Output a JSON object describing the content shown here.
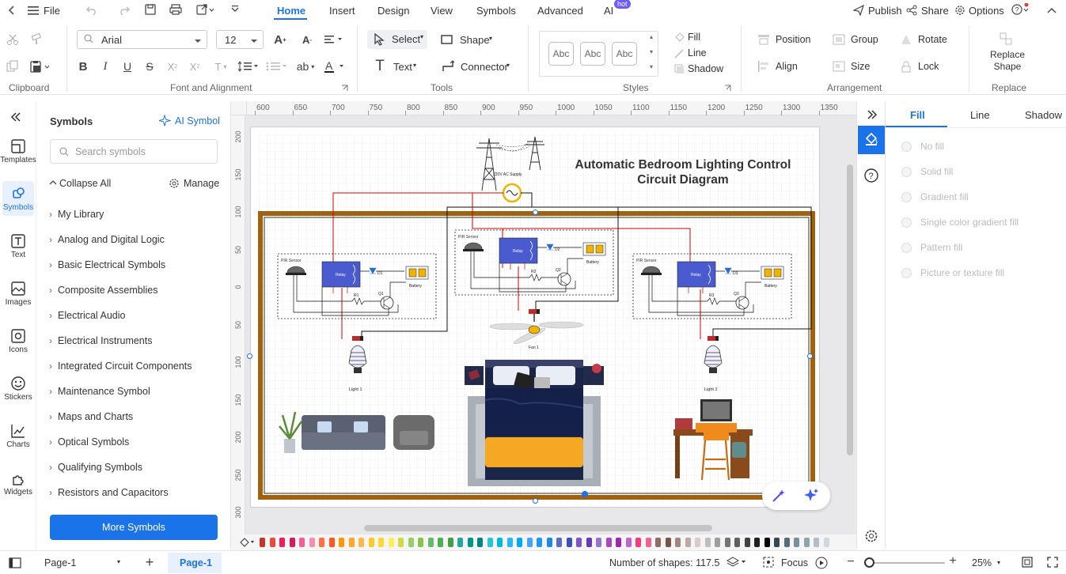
{
  "menubar": {
    "file_label": "File",
    "tabs": [
      "Home",
      "Insert",
      "Design",
      "View",
      "Symbols",
      "Advanced",
      "AI"
    ],
    "active_tab": "Home",
    "hot_badge": "hot",
    "publish_label": "Publish",
    "share_label": "Share",
    "options_label": "Options"
  },
  "ribbon": {
    "font_name": "Arial",
    "font_size": "12",
    "select_label": "Select",
    "shape_label": "Shape",
    "text_label": "Text",
    "connector_label": "Connector",
    "style_samples": [
      "Abc",
      "Abc",
      "Abc"
    ],
    "fill_label": "Fill",
    "line_label": "Line",
    "shadow_label": "Shadow",
    "position_label": "Position",
    "group_label": "Group",
    "rotate_label": "Rotate",
    "align_label": "Align",
    "size_label": "Size",
    "lock_label": "Lock",
    "replace_shape_label": "Replace Shape",
    "groups": {
      "clipboard": "Clipboard",
      "font": "Font and Alignment",
      "tools": "Tools",
      "styles": "Styles",
      "arrangement": "Arrangement",
      "replace": "Replace"
    }
  },
  "leftbar": {
    "items": [
      "Templates",
      "Symbols",
      "Text",
      "Images",
      "Icons",
      "Stickers",
      "Charts",
      "Widgets"
    ],
    "active": "Symbols"
  },
  "symbols_panel": {
    "title": "Symbols",
    "ai_symbol_label": "AI Symbol",
    "search_placeholder": "Search symbols",
    "collapse_all_label": "Collapse All",
    "manage_label": "Manage",
    "categories": [
      "My Library",
      "Analog and Digital Logic",
      "Basic Electrical Symbols",
      "Composite Assemblies",
      "Electrical Audio",
      "Electrical Instruments",
      "Integrated Circuit Components",
      "Maintenance Symbol",
      "Maps and Charts",
      "Optical Symbols",
      "Qualifying Symbols",
      "Resistors and Capacitors"
    ],
    "more_symbols_label": "More Symbols"
  },
  "ruler": {
    "h_ticks": [
      "600",
      "650",
      "700",
      "750",
      "800",
      "850",
      "900",
      "950",
      "1000",
      "1050",
      "1100",
      "1150",
      "1200",
      "1250",
      "1300",
      "1350"
    ],
    "v_ticks": [
      "200",
      "150",
      "100",
      "50",
      "0",
      "50",
      "100",
      "150",
      "200",
      "250",
      "300"
    ]
  },
  "diagram": {
    "title_line1": "Automatic Bedroom Lighting Control",
    "title_line2": "Circuit Diagram",
    "supply_label": "220V AC Supply",
    "pir_label": "PIR Sensor",
    "relay_label": "Relay",
    "battery_label": "Battery",
    "diode_labels": [
      "D1",
      "D2",
      "D3"
    ],
    "resistor_labels": [
      "R1",
      "R2",
      "R3"
    ],
    "transistor_labels": [
      "Q1",
      "Q2",
      "Q3"
    ],
    "fan_label": "Fan 1",
    "light_labels": [
      "Light 1",
      "Light 2"
    ]
  },
  "right_panel": {
    "tabs": [
      "Fill",
      "Line",
      "Shadow"
    ],
    "active_tab": "Fill",
    "fill_options": [
      "No fill",
      "Solid fill",
      "Gradient fill",
      "Single color gradient fill",
      "Pattern fill",
      "Picture or texture fill"
    ]
  },
  "palette": [
    "#c0392b",
    "#e74c3c",
    "#e91e63",
    "#d81b60",
    "#f06292",
    "#f48fb1",
    "#ff7043",
    "#ff5722",
    "#ff9800",
    "#ffa726",
    "#ffb74d",
    "#ffca28",
    "#fdd835",
    "#ffee58",
    "#cddc39",
    "#9ccc65",
    "#8bc34a",
    "#66bb6a",
    "#4caf50",
    "#43a047",
    "#26a69a",
    "#009688",
    "#00897b",
    "#26c6da",
    "#00bcd4",
    "#29b6f6",
    "#03a9f4",
    "#42a5f5",
    "#2196f3",
    "#1e88e5",
    "#5c6bc0",
    "#3f51b5",
    "#7e57c2",
    "#673ab7",
    "#9575cd",
    "#ab47bc",
    "#9c27b0",
    "#ba68c8",
    "#ec407a",
    "#f06292",
    "#8d6e63",
    "#795548",
    "#a1887f",
    "#bcaaa4",
    "#d7ccc8",
    "#bdbdbd",
    "#9e9e9e",
    "#757575",
    "#616161",
    "#424242",
    "#212121",
    "#000000",
    "#37474f",
    "#546e7a",
    "#78909c",
    "#90a4ae",
    "#b0bec5",
    "#cfd8dc"
  ],
  "statusbar": {
    "page_select": "Page-1",
    "page_tab": "Page-1",
    "shape_count": "Number of shapes: 117.5",
    "focus_label": "Focus",
    "zoom": "25%"
  },
  "colors": {
    "accent": "#1a73e8",
    "frame_brown": "#a0620f",
    "relay_blue": "#4a5bd0"
  }
}
